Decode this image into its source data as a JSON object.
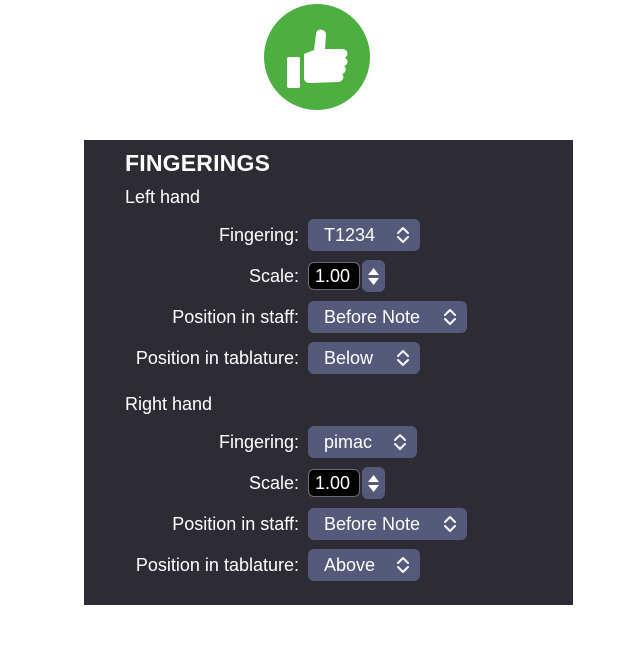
{
  "header": {
    "icon": "thumbs-up-icon",
    "icon_color": "#4caf3f"
  },
  "panel": {
    "title": "FINGERINGS",
    "left_hand": {
      "section_label": "Left hand",
      "fingering_label": "Fingering:",
      "fingering_value": "T1234",
      "scale_label": "Scale:",
      "scale_value": "1.00",
      "staff_label": "Position in staff:",
      "staff_value": "Before Note",
      "tab_label": "Position in tablature:",
      "tab_value": "Below"
    },
    "right_hand": {
      "section_label": "Right hand",
      "fingering_label": "Fingering:",
      "fingering_value": "pimac",
      "scale_label": "Scale:",
      "scale_value": "1.00",
      "staff_label": "Position in staff:",
      "staff_value": "Before Note",
      "tab_label": "Position in tablature:",
      "tab_value": "Above"
    }
  }
}
